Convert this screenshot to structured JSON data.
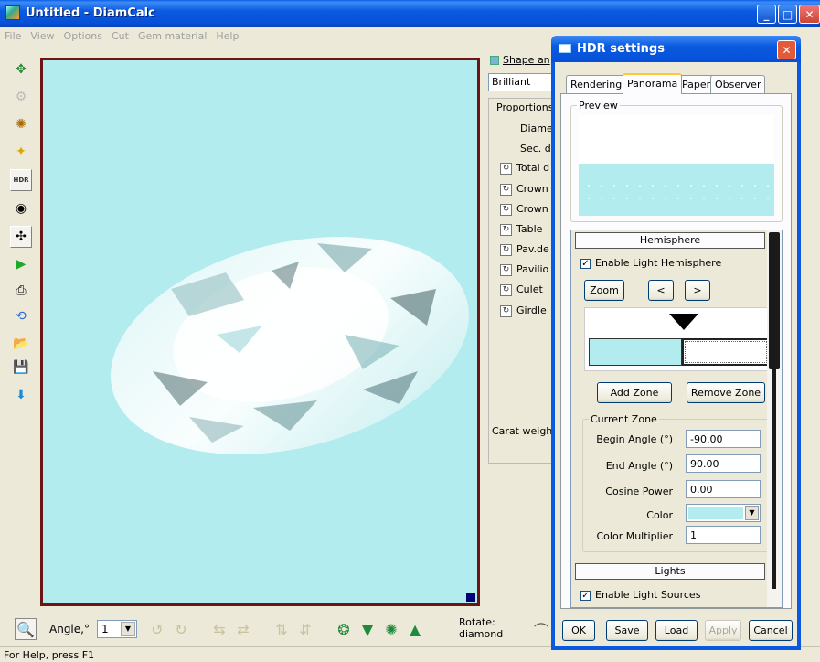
{
  "window": {
    "title": "Untitled - DiamCalc",
    "min": "_",
    "max": "□",
    "close": "✕"
  },
  "menu": [
    "File",
    "View",
    "Options",
    "Cut",
    "Gem material",
    "Help"
  ],
  "colors": {
    "viewport_bg": "#b2ecee",
    "viewport_border": "#6d1414",
    "titlebar": "#0a5ae0"
  },
  "left_toolbar": [
    {
      "name": "add-shape-icon",
      "glyph": "✥"
    },
    {
      "name": "disabled-tool-icon",
      "glyph": "⚙"
    },
    {
      "name": "gem-material-icon",
      "glyph": "✺"
    },
    {
      "name": "light-icon",
      "glyph": "✦"
    },
    {
      "name": "hdr-icon",
      "glyph": "HDR"
    },
    {
      "name": "camera-icon",
      "glyph": "◉"
    },
    {
      "name": "move-icon",
      "glyph": "✣"
    },
    {
      "name": "play-icon",
      "glyph": "▶"
    },
    {
      "name": "print-icon",
      "glyph": "⎙"
    },
    {
      "name": "scan-icon",
      "glyph": "⟲"
    },
    {
      "name": "open-icon",
      "glyph": "📂"
    },
    {
      "name": "save-icon",
      "glyph": "💾"
    },
    {
      "name": "export-icon",
      "glyph": "⬇"
    }
  ],
  "right_panel": {
    "shape_label": "Shape an",
    "shape_value": "Brilliant",
    "proportions_label": "Proportions",
    "rows_plain": [
      "Diame",
      "Sec. d"
    ],
    "rows_icon": [
      "Total d",
      "Crown",
      "Crown",
      "Table",
      "Pav.de",
      "Pavilio",
      "Culet",
      "Girdle"
    ],
    "carat_label": "Carat weight"
  },
  "bottom_toolbar": {
    "angle_label": "Angle,°",
    "angle_value": "1",
    "rotate_label": "Rotate:",
    "rotate_value": "diamond"
  },
  "status": {
    "text": "For Help, press F1"
  },
  "dialog": {
    "title": "HDR settings",
    "tabs": [
      "Rendering",
      "Panorama",
      "Paper",
      "Observer"
    ],
    "active_tab": "Panorama",
    "preview_label": "Preview",
    "hemisphere": {
      "header": "Hemisphere",
      "enable_label": "Enable Light Hemisphere",
      "enabled": true,
      "zoom_label": "Zoom",
      "prev_label": "<",
      "next_label": ">",
      "add_zone_label": "Add Zone",
      "remove_zone_label": "Remove Zone"
    },
    "current_zone": {
      "label": "Current Zone",
      "begin_angle_label": "Begin Angle (°)",
      "begin_angle_value": "-90.00",
      "end_angle_label": "End Angle (°)",
      "end_angle_value": "90.00",
      "cosine_power_label": "Cosine Power",
      "cosine_power_value": "0.00",
      "color_label": "Color",
      "color_value": "#b2ecee",
      "multiplier_label": "Color Multiplier",
      "multiplier_value": "1"
    },
    "lights": {
      "header": "Lights",
      "enable_label": "Enable Light Sources",
      "enabled": true
    },
    "buttons": {
      "ok": "OK",
      "save": "Save",
      "load": "Load",
      "apply": "Apply",
      "cancel": "Cancel"
    }
  }
}
